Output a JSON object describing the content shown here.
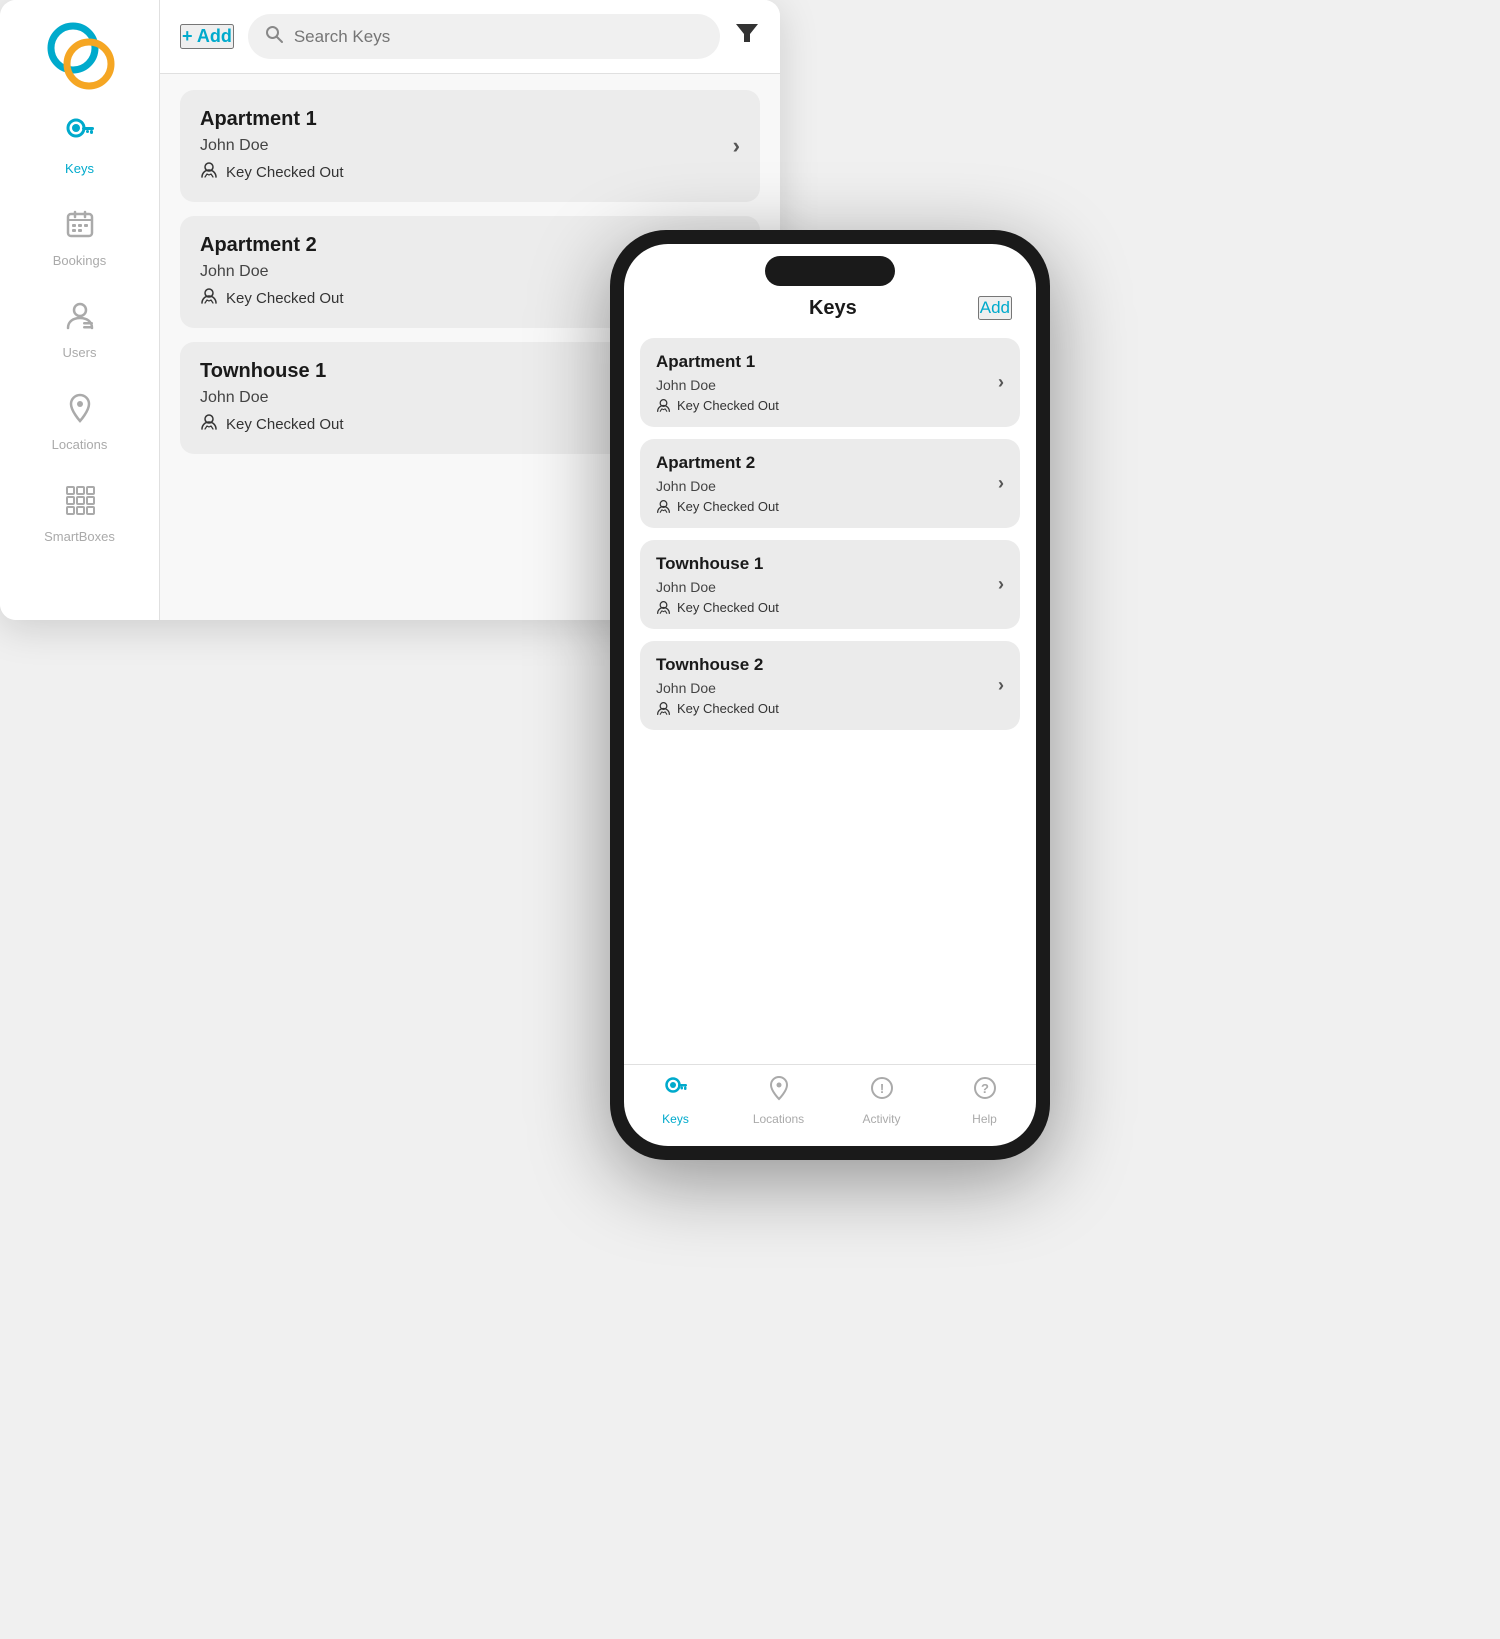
{
  "desktop": {
    "add_button": "+ Add",
    "search_placeholder": "Search Keys",
    "filter_icon": "▼",
    "keys": [
      {
        "title": "Apartment 1",
        "user": "John Doe",
        "status": "Key Checked Out"
      },
      {
        "title": "Apartment 2",
        "user": "John Doe",
        "status": "Key Checked Out"
      },
      {
        "title": "Townhouse 1",
        "user": "John Doe",
        "status": "Key Checked Out"
      }
    ],
    "sidebar": {
      "items": [
        {
          "label": "Keys",
          "icon": "🔑",
          "active": true
        },
        {
          "label": "Bookings",
          "icon": "📅",
          "active": false
        },
        {
          "label": "Users",
          "icon": "👤",
          "active": false
        },
        {
          "label": "Locations",
          "icon": "📍",
          "active": false
        },
        {
          "label": "SmartBoxes",
          "icon": "⊞",
          "active": false
        }
      ]
    }
  },
  "phone": {
    "title": "Keys",
    "add_button": "Add",
    "keys": [
      {
        "title": "Apartment 1",
        "user": "John Doe",
        "status": "Key Checked Out"
      },
      {
        "title": "Apartment 2",
        "user": "John Doe",
        "status": "Key Checked Out"
      },
      {
        "title": "Townhouse 1",
        "user": "John Doe",
        "status": "Key Checked Out"
      },
      {
        "title": "Townhouse 2",
        "user": "John Doe",
        "status": "Key Checked Out"
      }
    ],
    "bottom_nav": [
      {
        "label": "Keys",
        "active": true
      },
      {
        "label": "Locations",
        "active": false
      },
      {
        "label": "Activity",
        "active": false
      },
      {
        "label": "Help",
        "active": false
      }
    ]
  }
}
